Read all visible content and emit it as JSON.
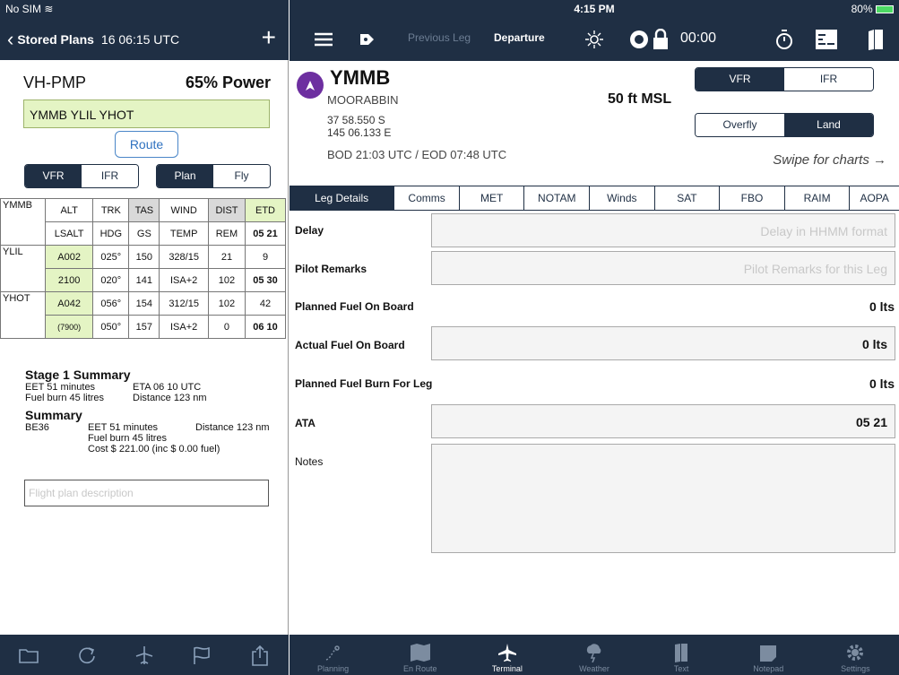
{
  "left_status": {
    "carrier": "No SIM"
  },
  "left_nav": {
    "back_label": "Stored Plans",
    "subtitle": "16 06:15 UTC"
  },
  "plan": {
    "registration": "VH-PMP",
    "power": "65% Power",
    "route": "YMMB YLIL YHOT",
    "route_button": "Route"
  },
  "toggles": {
    "vfr": "VFR",
    "ifr": "IFR",
    "plan": "Plan",
    "fly": "Fly"
  },
  "nav_table": {
    "header1": [
      "ALT",
      "TRK",
      "TAS",
      "WIND",
      "DIST",
      "ETD"
    ],
    "header2": [
      "LSALT",
      "HDG",
      "GS",
      "TEMP",
      "REM",
      "05 21"
    ],
    "rows": [
      {
        "waypoint": "YMMB"
      },
      {
        "waypoint": "YLIL",
        "r1": [
          "A002",
          "025°",
          "150",
          "328/15",
          "21",
          "9"
        ],
        "r2": [
          "2100",
          "020°",
          "141",
          "ISA+2",
          "102",
          "05 30"
        ]
      },
      {
        "waypoint": "YHOT",
        "r1": [
          "A042",
          "056°",
          "154",
          "312/15",
          "102",
          "42"
        ],
        "r2": [
          "(7900)",
          "050°",
          "157",
          "ISA+2",
          "0",
          "06 10"
        ]
      }
    ]
  },
  "summary": {
    "stage_title": "Stage 1 Summary",
    "eet": "EET 51 minutes",
    "eta": "ETA 06 10 UTC",
    "fuel": "Fuel burn 45 litres",
    "distance": "Distance 123 nm",
    "title": "Summary",
    "aircraft": "BE36",
    "s_eet": "EET 51 minutes",
    "s_distance": "Distance 123 nm",
    "s_fuel": "Fuel burn 45 litres",
    "s_cost": "Cost $ 221.00 (inc $ 0.00 fuel)",
    "description_placeholder": "Flight plan description"
  },
  "right_status": {
    "time": "4:15 PM",
    "battery": "80%"
  },
  "toolbar": {
    "previous_leg": "Previous Leg",
    "departure": "Departure",
    "timer": "00:00"
  },
  "airport": {
    "code": "YMMB",
    "name": "MOORABBIN",
    "lat": "37 58.550 S",
    "lon": "145 06.133 E",
    "elevation": "50 ft MSL",
    "bod": "BOD 21:03 UTC / EOD 07:48 UTC",
    "swipe": "Swipe for charts →",
    "vfr": "VFR",
    "ifr": "IFR",
    "overfly": "Overfly",
    "land": "Land"
  },
  "subtabs": [
    "Leg Details",
    "Comms",
    "MET",
    "NOTAM",
    "Winds",
    "SAT",
    "FBO",
    "RAIM",
    "AOPA"
  ],
  "leg": {
    "delay_label": "Delay",
    "delay_placeholder": "Delay in HHMM format",
    "remarks_label": "Pilot Remarks",
    "remarks_placeholder": "Pilot Remarks for this Leg",
    "pfob_label": "Planned Fuel On Board",
    "pfob_value": "0 lts",
    "afob_label": "Actual Fuel On Board",
    "afob_value": "0 lts",
    "pfb_label": "Planned Fuel Burn For Leg",
    "pfb_value": "0 lts",
    "ata_label": "ATA",
    "ata_value": "05 21",
    "notes_label": "Notes"
  },
  "bottom_tabs": [
    "Planning",
    "En Route",
    "Terminal",
    "Weather",
    "Text",
    "Notepad",
    "Settings"
  ]
}
